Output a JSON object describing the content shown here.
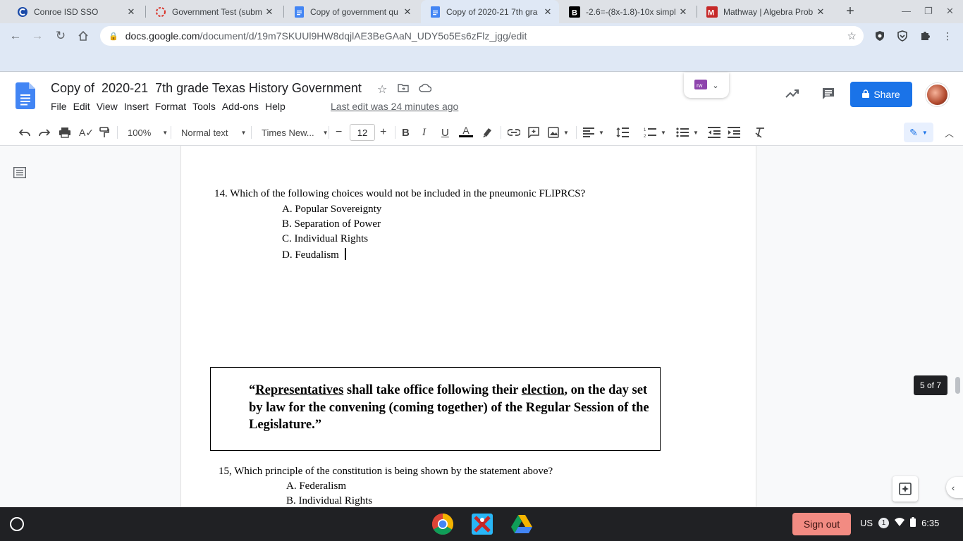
{
  "browser": {
    "tabs": [
      {
        "title": "Conroe ISD SSO",
        "icon": "conroe-favicon"
      },
      {
        "title": "Government Test (subm",
        "icon": "loading-favicon"
      },
      {
        "title": "Copy of government qu",
        "icon": "docs-favicon"
      },
      {
        "title": "Copy of 2020-21 7th gra",
        "icon": "docs-favicon",
        "active": true
      },
      {
        "title": "-2.6=-(8x-1.8)-10x simpl",
        "icon": "brainly-favicon"
      },
      {
        "title": "Mathway | Algebra Prob",
        "icon": "mathway-favicon"
      }
    ],
    "url_host": "docs.google.com",
    "url_path": "/document/d/19m7SKUUl9HW8dqjlAE3BeGAaN_UDY5o5Es6zFlz_jgg/edit"
  },
  "docs": {
    "title": "Copy of  2020-21  7th grade Texas History Government",
    "menu": [
      "File",
      "Edit",
      "View",
      "Insert",
      "Format",
      "Tools",
      "Add-ons",
      "Help"
    ],
    "last_edit": "Last edit was 24 minutes ago",
    "share_label": "Share",
    "addon_label": "rw",
    "toolbar": {
      "zoom": "100%",
      "style": "Normal text",
      "font": "Times New...",
      "font_size": "12"
    }
  },
  "document": {
    "q14": {
      "question": "14.  Which of the following choices would not be included in the pneumonic FLIPRCS?",
      "options": [
        "A.  Popular Sovereignty",
        "B.  Separation of Power",
        "C.  Individual Rights",
        "D.  Feudalism"
      ]
    },
    "quote": {
      "open": "“",
      "word1": "Representatives",
      "mid1": " shall take office following their ",
      "word2": "election",
      "rest": ", on the day set by law for the convening (coming together) of the Regular Session of the Legislature.”"
    },
    "q15": {
      "question": "15, Which principle of the constitution is being shown by the statement above?",
      "options": [
        "A.  Federalism",
        "B.  Individual Rights"
      ]
    },
    "page_indicator": "5 of 7"
  },
  "shelf": {
    "sign_out": "Sign out",
    "locale": "US",
    "notifications": "1",
    "time": "6:35"
  },
  "colors": {
    "docs_blue": "#1a73e8",
    "chrome_frame": "#dee1e6",
    "shelf": "#202124",
    "sign_out": "#f28b82"
  }
}
